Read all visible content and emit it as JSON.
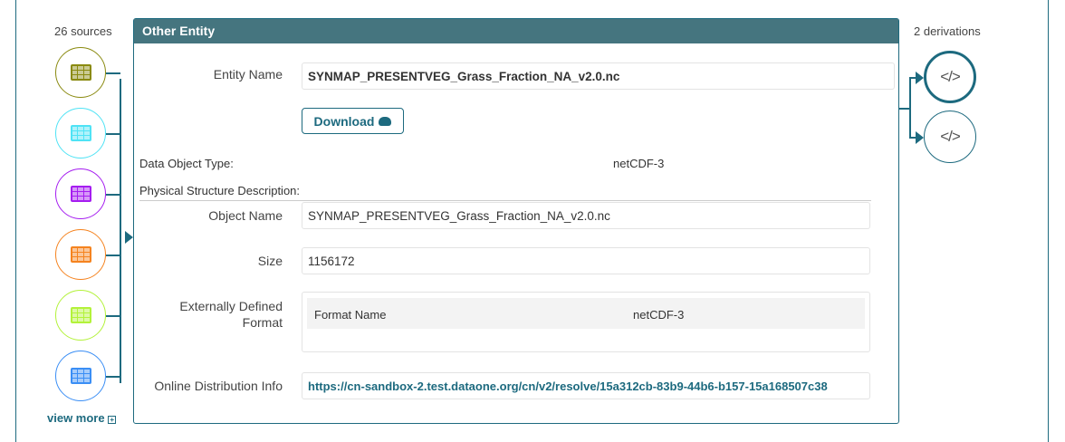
{
  "sources": {
    "count_label": "26 sources",
    "view_more": "view more",
    "items": [
      {
        "icon": "table-icon",
        "color": "#8a8a10"
      },
      {
        "icon": "table-icon",
        "color": "#4fe3f5"
      },
      {
        "icon": "table-icon",
        "color": "#a51df0"
      },
      {
        "icon": "table-icon",
        "color": "#f5831f"
      },
      {
        "icon": "table-icon",
        "color": "#b3f23a"
      },
      {
        "icon": "table-icon",
        "color": "#3a8ef5"
      }
    ]
  },
  "derivations": {
    "count_label": "2 derivations",
    "items": [
      {
        "icon": "code-icon",
        "glyph": "</>"
      },
      {
        "icon": "code-icon",
        "glyph": "</>"
      }
    ]
  },
  "panel": {
    "title": "Other Entity",
    "entity_name_label": "Entity Name",
    "entity_name": "SYNMAP_PRESENTVEG_Grass_Fraction_NA_v2.0.nc",
    "download_label": "Download",
    "data_object_type_label": "Data Object Type:",
    "data_object_type": "netCDF-3",
    "physical_structure_label": "Physical Structure Description:",
    "object_name_label": "Object Name",
    "object_name": "SYNMAP_PRESENTVEG_Grass_Fraction_NA_v2.0.nc",
    "size_label": "Size",
    "size": "1156172",
    "ext_format_label_1": "Externally Defined",
    "ext_format_label_2": "Format",
    "format_name_label": "Format Name",
    "format_name": "netCDF-3",
    "online_dist_label": "Online Distribution Info",
    "online_dist_url": "https://cn-sandbox-2.test.dataone.org/cn/v2/resolve/15a312cb-83b9-44b6-b157-15a168507c38"
  },
  "colors": {
    "accent": "#1d6a7f",
    "header": "#45757f"
  }
}
